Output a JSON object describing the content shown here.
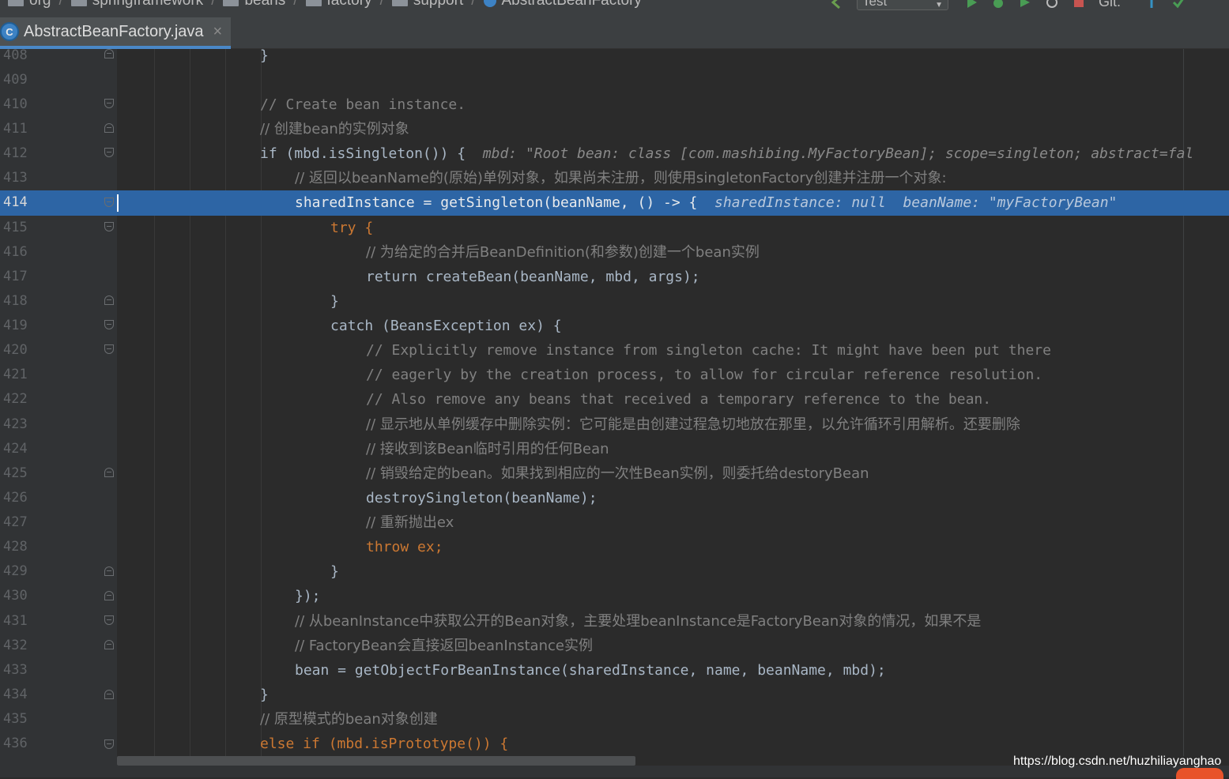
{
  "breadcrumb": [
    "org",
    "springframework",
    "beans",
    "factory",
    "support",
    "AbstractBeanFactory"
  ],
  "toolbar": {
    "run_config": "Test",
    "git_label": "Git:"
  },
  "tab": {
    "file_name": "AbstractBeanFactory.java",
    "icon_letter": "C"
  },
  "editor": {
    "current_line": 414,
    "lines": [
      {
        "n": "408",
        "code": "}"
      },
      {
        "n": "409",
        "code": ""
      },
      {
        "n": "410",
        "code": "// Create bean instance."
      },
      {
        "n": "411",
        "code": "// 创建bean的实例对象"
      },
      {
        "n": "412",
        "code": "if (mbd.isSingleton()) {",
        "hint": "mbd: \"Root bean: class [com.mashibing.MyFactoryBean]; scope=singleton; abstract=fal"
      },
      {
        "n": "413",
        "code": "// 返回以beanName的(原始)单例对象，如果尚未注册，则使用singletonFactory创建并注册一个对象:"
      },
      {
        "n": "414",
        "code": "sharedInstance = getSingleton(beanName, () -> {",
        "hint1": "sharedInstance: null",
        "hint2": "beanName: \"myFactoryBean\""
      },
      {
        "n": "415",
        "code": "try {"
      },
      {
        "n": "416",
        "code": "// 为给定的合并后BeanDefinition(和参数)创建一个bean实例"
      },
      {
        "n": "417",
        "code": "return createBean(beanName, mbd, args);"
      },
      {
        "n": "418",
        "code": "}"
      },
      {
        "n": "419",
        "code": "catch (BeansException ex) {"
      },
      {
        "n": "420",
        "code": "// Explicitly remove instance from singleton cache: It might have been put there"
      },
      {
        "n": "421",
        "code": "// eagerly by the creation process, to allow for circular reference resolution."
      },
      {
        "n": "422",
        "code": "// Also remove any beans that received a temporary reference to the bean."
      },
      {
        "n": "423",
        "code": "// 显示地从单例缓存中删除实例：它可能是由创建过程急切地放在那里，以允许循环引用解析。还要删除"
      },
      {
        "n": "424",
        "code": "// 接收到该Bean临时引用的任何Bean"
      },
      {
        "n": "425",
        "code": "// 销毁给定的bean。如果找到相应的一次性Bean实例，则委托给destoryBean"
      },
      {
        "n": "426",
        "code": "destroySingleton(beanName);"
      },
      {
        "n": "427",
        "code": "// 重新抛出ex"
      },
      {
        "n": "428",
        "code": "throw ex;"
      },
      {
        "n": "429",
        "code": "}"
      },
      {
        "n": "430",
        "code": "});"
      },
      {
        "n": "431",
        "code": "// 从beanInstance中获取公开的Bean对象，主要处理beanInstance是FactoryBean对象的情况，如果不是"
      },
      {
        "n": "432",
        "code": "// FactoryBean会直接返回beanInstance实例"
      },
      {
        "n": "433",
        "code": "bean = getObjectForBeanInstance(sharedInstance, name, beanName, mbd);"
      },
      {
        "n": "434",
        "code": "}"
      },
      {
        "n": "435",
        "code": "// 原型模式的bean对象创建"
      },
      {
        "n": "436",
        "code": "else if (mbd.isPrototype()) {"
      }
    ]
  },
  "watermark": "https://blog.csdn.net/huzhiliayanghao",
  "colors": {
    "background": "#2b2b2b",
    "gutter": "#313335",
    "current_line": "#2d65a5",
    "keyword": "#cc7832",
    "comment": "#808080",
    "field": "#9876aa",
    "tab_underline": "#4a88c7"
  }
}
